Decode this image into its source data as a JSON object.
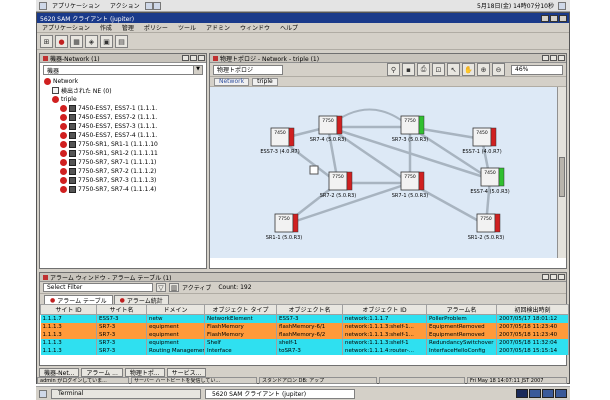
{
  "desktop": {
    "menus": [
      "アプリケーション",
      "アクション"
    ],
    "clock": "5月18日(金) 14時07分10秒"
  },
  "app": {
    "title": "5620 SAM クライアント (jupiter)",
    "menus": [
      "アプリケーション",
      "作成",
      "管理",
      "ポリシー",
      "ツール",
      "アドミン",
      "ウィンドウ",
      "ヘルプ"
    ]
  },
  "equipment": {
    "title": "機器-Network (1)",
    "combo": "機器",
    "tree": [
      {
        "label": "Network",
        "level": 0,
        "icon": "red"
      },
      {
        "label": "検出された NE (0)",
        "level": 1,
        "icon": "ne"
      },
      {
        "label": "triple",
        "level": 1,
        "icon": "red"
      },
      {
        "label": "7450-ESS7, ESS7-1 (1.1.1.",
        "level": 2,
        "icon": "grid"
      },
      {
        "label": "7450-ESS7, ESS7-2 (1.1.1.",
        "level": 2,
        "icon": "grid"
      },
      {
        "label": "7450-ESS7, ESS7-3 (1.1.1.",
        "level": 2,
        "icon": "grid"
      },
      {
        "label": "7450-ESS7, ESS7-4 (1.1.1.",
        "level": 2,
        "icon": "grid"
      },
      {
        "label": "7750-SR1, SR1-1 (1.1.1.10",
        "level": 2,
        "icon": "grid"
      },
      {
        "label": "7750-SR1, SR1-2 (1.1.1.11",
        "level": 2,
        "icon": "grid"
      },
      {
        "label": "7750-SR7, SR7-1 (1.1.1.1)",
        "level": 2,
        "icon": "grid"
      },
      {
        "label": "7750-SR7, SR7-2 (1.1.1.2)",
        "level": 2,
        "icon": "grid"
      },
      {
        "label": "7750-SR7, SR7-3 (1.1.1.3)",
        "level": 2,
        "icon": "grid"
      },
      {
        "label": "7750-SR7, SR7-4 (1.1.1.4)",
        "level": 2,
        "icon": "grid"
      }
    ]
  },
  "topology": {
    "title": "物理トポロジ - Network - triple (1)",
    "combo": "物理トポロジ",
    "zoom": "46%",
    "breadcrumbs": [
      "Network",
      "triple"
    ],
    "nodes": [
      {
        "id": "n1",
        "model": "7450",
        "label": "ESS7-3 (4.0.R7)"
      },
      {
        "id": "n2",
        "model": "7750",
        "label": "SR7-4 (5.0.R3)"
      },
      {
        "id": "n3",
        "model": "7750",
        "label": "SR7-3 (5.0.R3)"
      },
      {
        "id": "n4",
        "model": "7450",
        "label": "ESS7-1 (4.0.R7)"
      },
      {
        "id": "n5",
        "model": "7750",
        "label": "SR7-2 (5.0.R3)"
      },
      {
        "id": "n6",
        "model": "7750",
        "label": "SR7-1 (5.0.R3)"
      },
      {
        "id": "n7",
        "model": "7450",
        "label": "ESS7-4 (5.0.R3)"
      },
      {
        "id": "n8",
        "model": "7750",
        "label": "SR1-1 (5.0.R3)"
      },
      {
        "id": "n9",
        "model": "7750",
        "label": "SR1-2 (5.0.R3)"
      }
    ]
  },
  "alarm": {
    "title": "アラーム ウィンドウ - アラーム テーブル (1)",
    "filter": "Select Filter",
    "active_label": "アクティブ",
    "count": "Count: 192",
    "tabs": [
      "アラーム テーブル",
      "アラーム統計"
    ],
    "columns": [
      "サイト ID",
      "サイト名",
      "ドメイン",
      "オブジェクト タイプ",
      "オブジェクト名",
      "オブジェクト ID",
      "アラーム名",
      "初回検出時刻"
    ],
    "rows": [
      {
        "color": "#2fe0f0",
        "cells": [
          "1.1.1.7",
          "ESS7-3",
          "netw",
          "NetworkElement",
          "ESS7-3",
          "network:1.1.1.7",
          "PollerProblem",
          "2007/05/17 18:01:12"
        ]
      },
      {
        "color": "#ff9a3a",
        "cells": [
          "1.1.1.3",
          "SR7-3",
          "equipment",
          "FlashMemory",
          "flashMemory-6/1",
          "network:1.1.1.3:shelf-1...",
          "EquipmentRemoved",
          "2007/05/18 11:23:40"
        ]
      },
      {
        "color": "#ff9a3a",
        "cells": [
          "1.1.1.3",
          "SR7-3",
          "equipment",
          "FlashMemory",
          "flashMemory-6/2",
          "network:1.1.1.3:shelf-1...",
          "EquipmentRemoved",
          "2007/05/18 11:23:40"
        ]
      },
      {
        "color": "#2fe0f0",
        "cells": [
          "1.1.1.3",
          "SR7-3",
          "equipment",
          "Shelf",
          "shelf-1",
          "network:1.1.1.3:shelf-1",
          "RedundancySwitchover",
          "2007/05/18 11:32:04"
        ]
      },
      {
        "color": "#2fe0f0",
        "cells": [
          "1.1.1.3",
          "SR7-3",
          "Routing Management",
          "Interface",
          "toSR7-3",
          "network:1.1.1.4:router-...",
          "InterfaceHelloConfig",
          "2007/05/18 15:15:14"
        ]
      }
    ]
  },
  "appbar": [
    "機器-Net...",
    "アラーム ...",
    "物理トポ...",
    "サービス..."
  ],
  "status": {
    "cells": [
      "admin がログインしていま...",
      "サーバー ハートビートを受信してい...",
      "スタンドアロン DB: アップ",
      "",
      "Fri May 18 14:07:11 JST 2007"
    ]
  },
  "taskbar": {
    "items": [
      "Terminal",
      "5620 SAM クライアント (jupiter)"
    ]
  },
  "colors": {
    "alarm_cyan": "#2fe0f0",
    "alarm_orange": "#ff9a3a",
    "canvas": "#dde9f6",
    "title_blue": "#1a3a8a"
  }
}
